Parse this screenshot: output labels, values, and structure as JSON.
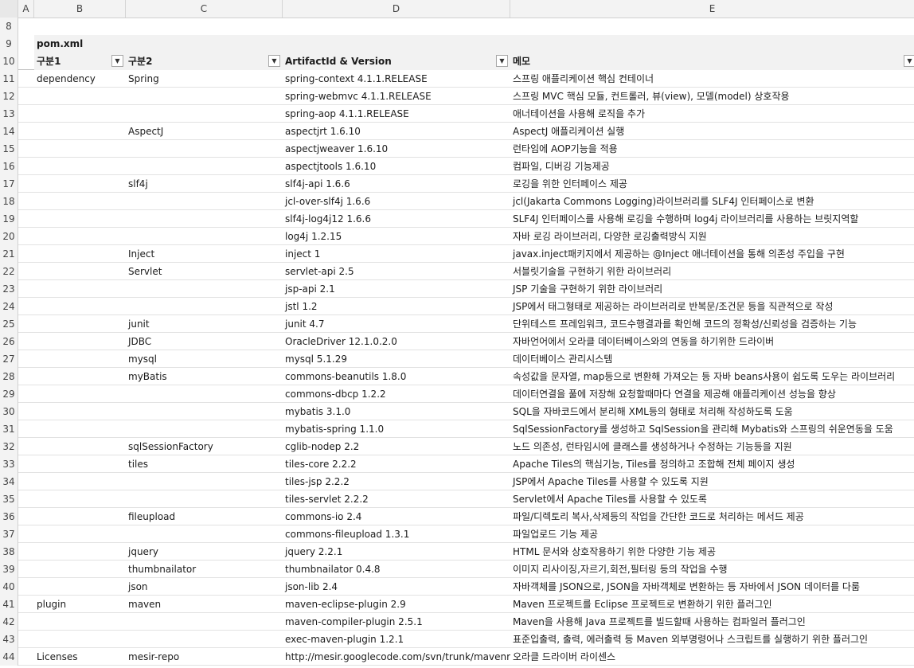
{
  "columns": [
    "A",
    "B",
    "C",
    "D",
    "E"
  ],
  "title_row": {
    "row": "9",
    "title": "pom.xml"
  },
  "empty_row": {
    "row": "8"
  },
  "header": {
    "row": "10",
    "col_b": "구분1",
    "col_c": "구분2",
    "col_d": "ArtifactId & Version",
    "col_e": "메모"
  },
  "filter_icon": "dropdown-arrow-icon",
  "rows": [
    {
      "row": "11",
      "b": "dependency",
      "c": "Spring",
      "d": "spring-context 4.1.1.RELEASE",
      "e": "스프링 애플리케이션 핵심 컨테이너"
    },
    {
      "row": "12",
      "b": "",
      "c": "",
      "d": "spring-webmvc 4.1.1.RELEASE",
      "e": "스프링 MVC 핵심 모듈, 컨트롤러, 뷰(view), 모델(model) 상호작용"
    },
    {
      "row": "13",
      "b": "",
      "c": "",
      "d": "spring-aop 4.1.1.RELEASE",
      "e": "애너테이션을 사용해 로직을 추가"
    },
    {
      "row": "14",
      "b": "",
      "c": "AspectJ",
      "d": "aspectjrt 1.6.10",
      "e": "AspectJ 애플리케이션 실행"
    },
    {
      "row": "15",
      "b": "",
      "c": "",
      "d": "aspectjweaver 1.6.10",
      "e": "런타임에 AOP기능을 적용"
    },
    {
      "row": "16",
      "b": "",
      "c": "",
      "d": "aspectjtools 1.6.10",
      "e": "컴파일, 디버깅 기능제공"
    },
    {
      "row": "17",
      "b": "",
      "c": "slf4j",
      "d": "slf4j-api 1.6.6",
      "e": "로깅을 위한 인터페이스 제공"
    },
    {
      "row": "18",
      "b": "",
      "c": "",
      "d": "jcl-over-slf4j 1.6.6",
      "e": "jcl(Jakarta Commons Logging)라이브러리를 SLF4J 인터페이스로 변환"
    },
    {
      "row": "19",
      "b": "",
      "c": "",
      "d": "slf4j-log4j12 1.6.6",
      "e": "SLF4J 인터페이스를 사용해 로깅을 수행하며 log4j 라이브러리를 사용하는 브릿지역할"
    },
    {
      "row": "20",
      "b": "",
      "c": "",
      "d": "log4j 1.2.15",
      "e": "자바 로깅 라이브러리, 다양한 로깅출력방식 지원"
    },
    {
      "row": "21",
      "b": "",
      "c": "Inject",
      "d": "inject 1",
      "e": "javax.inject패키지에서 제공하는 @Inject 애너테이션을 통해 의존성 주입을 구현"
    },
    {
      "row": "22",
      "b": "",
      "c": "Servlet",
      "d": "servlet-api 2.5",
      "e": "서블릿기술을 구현하기 위한 라이브러리"
    },
    {
      "row": "23",
      "b": "",
      "c": "",
      "d": "jsp-api 2.1",
      "e": "JSP 기술을 구현하기 위한 라이브러리"
    },
    {
      "row": "24",
      "b": "",
      "c": "",
      "d": "jstl 1.2",
      "e": "JSP에서 태그형태로 제공하는 라이브러리로 반복문/조건문 등을 직관적으로 작성"
    },
    {
      "row": "25",
      "b": "",
      "c": "junit",
      "d": "junit 4.7",
      "e": "단위테스트 프레임워크, 코드수행결과를 확인해 코드의 정확성/신뢰성을 검증하는 기능"
    },
    {
      "row": "26",
      "b": "",
      "c": "JDBC",
      "d": "OracleDriver 12.1.0.2.0",
      "e": "자바언어에서 오라클 데이터베이스와의 연동을 하기위한 드라이버"
    },
    {
      "row": "27",
      "b": "",
      "c": "mysql",
      "d": "mysql 5.1.29",
      "e": "데이터베이스 관리시스템"
    },
    {
      "row": "28",
      "b": "",
      "c": "myBatis",
      "d": "commons-beanutils 1.8.0",
      "e": "속성값을 문자열, map등으로 변환해 가져오는 등 자바 beans사용이 쉽도록 도우는 라이브러리"
    },
    {
      "row": "29",
      "b": "",
      "c": "",
      "d": "commons-dbcp 1.2.2",
      "e": "데이터연결을 풀에 저장해 요청할때마다 연결을 제공해 애플리케이션 성능을 향상"
    },
    {
      "row": "30",
      "b": "",
      "c": "",
      "d": "mybatis 3.1.0",
      "e": "SQL을 자바코드에서 분리해 XML등의 형태로 처리해 작성하도록 도움"
    },
    {
      "row": "31",
      "b": "",
      "c": "",
      "d": "mybatis-spring 1.1.0",
      "e": "SqlSessionFactory를 생성하고 SqlSession을 관리해 Mybatis와 스프링의 쉬운연동을 도움"
    },
    {
      "row": "32",
      "b": "",
      "c": "sqlSessionFactory",
      "d": "cglib-nodep 2.2",
      "e": "노드 의존성, 런타임시에 클래스를 생성하거나 수정하는 기능등을 지원"
    },
    {
      "row": "33",
      "b": "",
      "c": "tiles",
      "d": "tiles-core 2.2.2",
      "e": "Apache Tiles의 핵심기능, Tiles를 정의하고 조합해 전체 페이지 생성"
    },
    {
      "row": "34",
      "b": "",
      "c": "",
      "d": "tiles-jsp 2.2.2",
      "e": "JSP에서 Apache Tiles를 사용할 수 있도록 지원"
    },
    {
      "row": "35",
      "b": "",
      "c": "",
      "d": "tiles-servlet 2.2.2",
      "e": "Servlet에서 Apache Tiles를 사용할 수 있도록"
    },
    {
      "row": "36",
      "b": "",
      "c": "fileupload",
      "d": "commons-io 2.4",
      "e": "파일/디렉토리 복사,삭제등의 작업을 간단한 코드로 처리하는 메서드 제공"
    },
    {
      "row": "37",
      "b": "",
      "c": "",
      "d": "commons-fileupload 1.3.1",
      "e": "파일업로드 기능 제공"
    },
    {
      "row": "38",
      "b": "",
      "c": "jquery",
      "d": "jquery 2.2.1",
      "e": "HTML 문서와 상호작용하기 위한 다양한 기능 제공"
    },
    {
      "row": "39",
      "b": "",
      "c": "thumbnailator",
      "d": "thumbnailator 0.4.8",
      "e": "이미지 리사이징,자르기,회전,필터링 등의  작업을 수행"
    },
    {
      "row": "40",
      "b": "",
      "c": "json",
      "d": "json-lib 2.4",
      "e": "자바객체를 JSON으로, JSON을 자바객체로 변환하는 등 자바에서 JSON 데이터를 다룸"
    },
    {
      "row": "41",
      "b": "plugin",
      "c": "maven",
      "d": "maven-eclipse-plugin 2.9",
      "e": "Maven 프로젝트를 Eclipse 프로젝트로 변환하기 위한 플러그인"
    },
    {
      "row": "42",
      "b": "",
      "c": "",
      "d": "maven-compiler-plugin 2.5.1",
      "e": "Maven을 사용해 Java 프로젝트를 빌드할때 사용하는 컴파일러 플러그인"
    },
    {
      "row": "43",
      "b": "",
      "c": "",
      "d": "exec-maven-plugin 1.2.1",
      "e": "표준입출력, 출력, 에러출력 등 Maven 외부명령어나 스크립트를 실행하기 위한 플러그인"
    },
    {
      "row": "44",
      "b": "Licenses",
      "c": "mesir-repo",
      "d": "http://mesir.googlecode.com/svn/trunk/mavenrepo",
      "e": "오라클 드라이버 라이센스"
    }
  ]
}
